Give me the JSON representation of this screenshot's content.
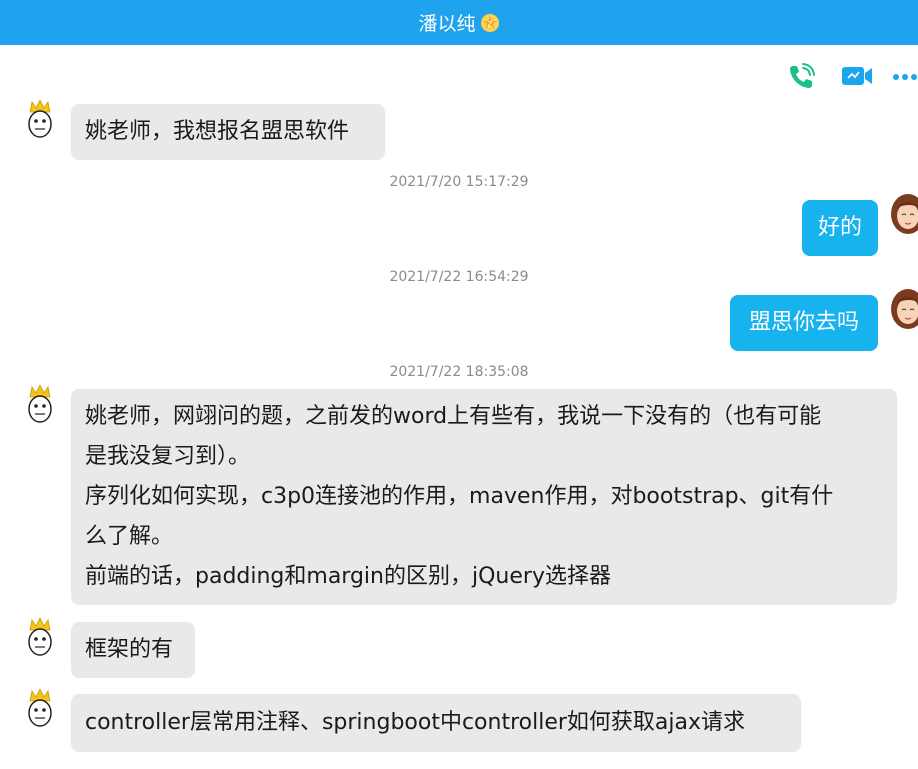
{
  "header": {
    "title": "潘以纯"
  },
  "toolbar": {
    "icons": [
      "phone-icon",
      "video-call-icon",
      "more-icon"
    ]
  },
  "colors": {
    "titlebar": "#1fa3ee",
    "bubble_left": "#e9e9e9",
    "bubble_right": "#17b3ef",
    "timestamp": "#8b8b8b"
  },
  "messages": {
    "m1": "姚老师，我想报名盟思软件",
    "t1": "2021/7/20 15:17:29",
    "m2": "好的",
    "t2": "2021/7/22 16:54:29",
    "m3": "盟思你去吗",
    "t3": "2021/7/22 18:35:08",
    "m4": {
      "line1": "姚老师，网翊问的题，之前发的word上有些有，我说一下没有的（也有可能",
      "line2": "是我没复习到）。",
      "line3": "序列化如何实现，c3p0连接池的作用，maven作用，对bootstrap、git有什",
      "line4": "么了解。",
      "line5": "前端的话，padding和margin的区别，jQuery选择器"
    },
    "m5": "框架的有",
    "m6": "controller层常用注释、springboot中controller如何获取ajax请求"
  }
}
